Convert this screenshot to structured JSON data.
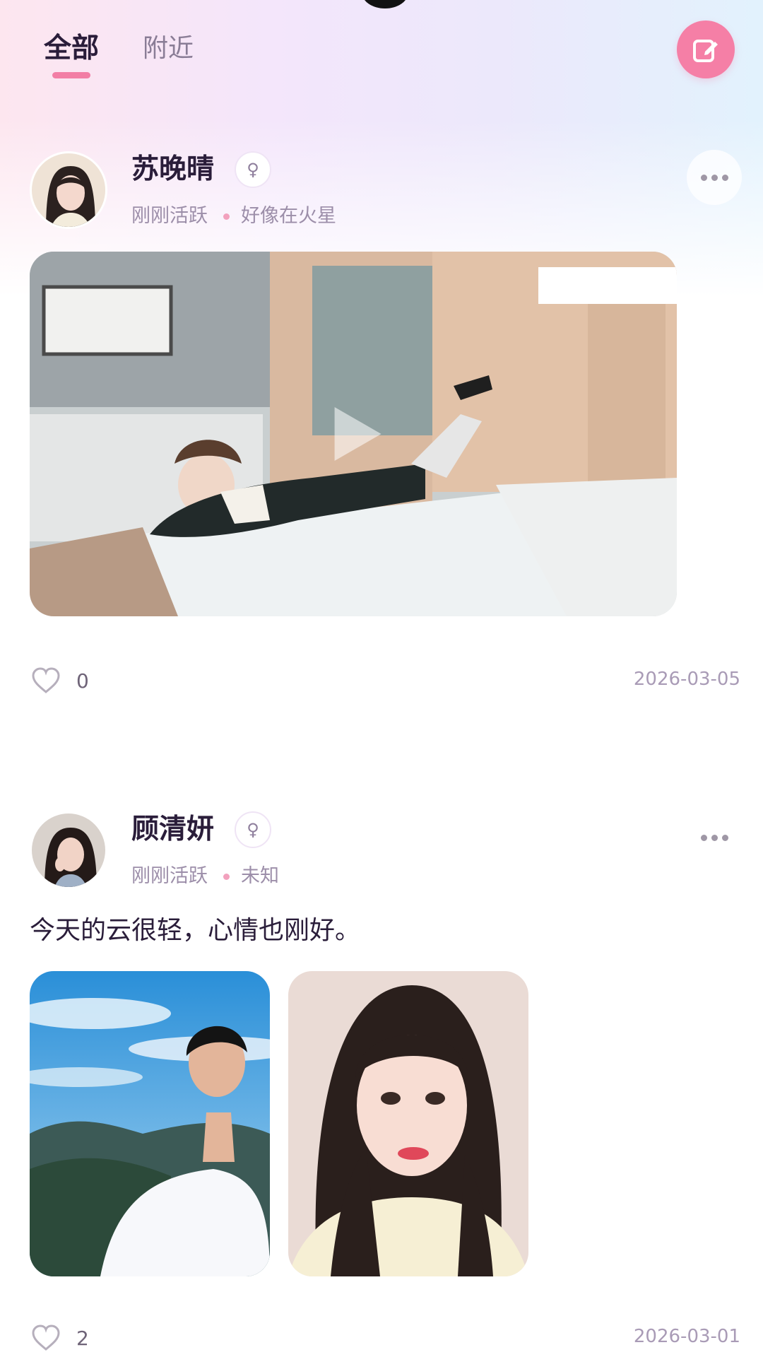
{
  "tabs": [
    {
      "label": "全部",
      "active": true
    },
    {
      "label": "附近",
      "active": false
    }
  ],
  "compose": {
    "icon": "edit-icon",
    "color": "#f57fa6"
  },
  "posts": [
    {
      "username": "苏晚晴",
      "gender_symbol": "♀",
      "status": "刚刚活跃",
      "location": "好像在火星",
      "media_type": "video",
      "text": "",
      "likes": "0",
      "date": "2026-03-05"
    },
    {
      "username": "顾清妍",
      "gender_symbol": "♀",
      "status": "刚刚活跃",
      "location": "未知",
      "media_type": "images",
      "text": "今天的云很轻，心情也刚好。",
      "likes": "2",
      "date": "2026-03-01"
    }
  ]
}
